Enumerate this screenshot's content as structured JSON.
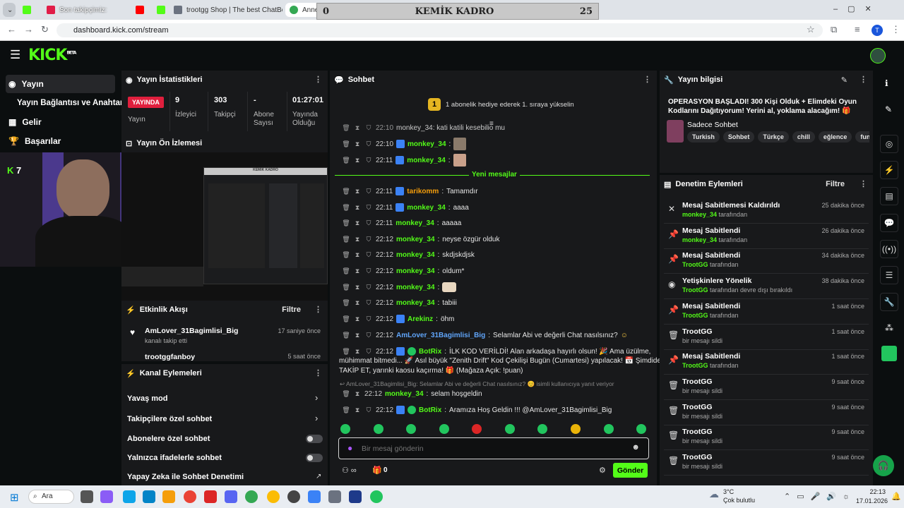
{
  "browser": {
    "tabs": [
      {
        "label": "Son takipçimiz:"
      },
      {
        "label": "trootgg Shop | The best ChatBot"
      },
      {
        "label": "Annecy · Google Haritalar"
      }
    ],
    "overlay_left": "0",
    "overlay_title": "KEMİK KADRO",
    "overlay_right": "25",
    "url": "dashboard.kick.com/stream",
    "profile_initial": "T"
  },
  "sidebar": {
    "items": [
      {
        "label": "Yayın",
        "icon": "stream-icon"
      },
      {
        "label": "Yayın Bağlantısı ve Anahtarı",
        "icon": ""
      },
      {
        "label": "Gelir",
        "icon": "revenue-icon"
      },
      {
        "label": "Başarılar",
        "icon": "trophy-icon"
      }
    ]
  },
  "stats": {
    "title": "Yayın İstatistikleri",
    "live_badge": "YAYINDA",
    "live_label": "Yayın",
    "cols": [
      {
        "value": "9",
        "label": "İzleyici"
      },
      {
        "value": "303",
        "label": "Takipçi"
      },
      {
        "value": "-",
        "label": "Abone Sayısı"
      },
      {
        "value": "01:27:01",
        "label": "Yayında Olduğu"
      }
    ]
  },
  "preview": {
    "title": "Yayın Ön İzlemesi",
    "cam_counter": "7",
    "inner_title": "KEMİK KADRO"
  },
  "activity": {
    "title": "Etkinlik Akışı",
    "filter": "Filtre",
    "items": [
      {
        "user": "AmLover_31Bagimlisi_Big",
        "action": "kanalı takip etti",
        "time": "17 saniye önce"
      },
      {
        "user": "trootggfanboy",
        "action": "",
        "time": "5 saat önce"
      }
    ]
  },
  "channel_actions": {
    "title": "Kanal Eylemeleri",
    "items": [
      {
        "label": "Yavaş mod",
        "type": "arrow"
      },
      {
        "label": "Takipçilere özel sohbet",
        "type": "arrow"
      },
      {
        "label": "Abonelere özel sohbet",
        "type": "toggle"
      },
      {
        "label": "Yalnızca ifadelerle sohbet",
        "type": "toggle"
      },
      {
        "label": "Yapay Zeka ile Sohbet Denetimi",
        "type": "link"
      }
    ]
  },
  "chat": {
    "title": "Sohbet",
    "pinned_rank": "1",
    "pinned_text": "1 abonelik hediye ederek 1. sıraya yükselin",
    "top_partial": "monkey_34: kati katili kesebilio mu",
    "top_partial_time": "22:10",
    "new_messages": "Yeni mesajlar",
    "messages": [
      {
        "time": "22:10",
        "user": "monkey_34",
        "text": ""
      },
      {
        "time": "22:11",
        "user": "monkey_34",
        "text": ""
      },
      {
        "time": "22:11",
        "user": "tarikomm",
        "text": "Tamamdır"
      },
      {
        "time": "22:11",
        "user": "monkey_34",
        "text": "aaaa"
      },
      {
        "time": "22:11",
        "user": "monkey_34",
        "text": "aaaaa"
      },
      {
        "time": "22:12",
        "user": "monkey_34",
        "text": "neyse özgür olduk"
      },
      {
        "time": "22:12",
        "user": "monkey_34",
        "text": "skdjskdjsk"
      },
      {
        "time": "22:12",
        "user": "monkey_34",
        "text": "oldum*"
      },
      {
        "time": "22:12",
        "user": "monkey_34",
        "text": ""
      },
      {
        "time": "22:12",
        "user": "monkey_34",
        "text": "tabiii"
      },
      {
        "time": "22:12",
        "user": "Arekinz",
        "text": "öhm"
      },
      {
        "time": "22:12",
        "user": "AmLover_31Bagimlisi_Big",
        "text": "Selamlar Abi ve değerli Chat nasılsınız?"
      }
    ],
    "botrix_1_time": "22:12",
    "botrix_user": "BotRix",
    "botrix_1_line1": "İLK KOD VERİLDİ! Alan arkadaşa hayırlı olsun! 🎉 Ama üzülme,",
    "botrix_1_line2": "mühimmat bitmedi... 🚀 Asıl büyük \"Zenith Drift\" Kod Çekilişi Bugün (Cumartesi) yapılacak! 📅 Şimdiden",
    "botrix_1_line3": "TAKİP ET, yarınki kaosu kaçırma! 🎁 (Mağaza Açık: !puan)",
    "reply_context": "AmLover_31Bagimlisi_Big: Selamlar Abi ve değerli Chat nasılsınız? 😊 isimli kullanıcıya yanıt veriyor",
    "reply_time": "22:12",
    "reply_user": "monkey_34",
    "reply_text": "selam hoşgeldin",
    "botrix_2_time": "22:12",
    "botrix_2_text": "Aramıza Hoş Geldin !!! @AmLover_31Bagimlisi_Big",
    "input_placeholder": "Bir mesaj gönderin",
    "points": "0",
    "send_label": "Gönder"
  },
  "stream_info": {
    "title": "Yayın bilgisi",
    "headline_line1": "OPERASYON BAŞLADI! 300 Kişi Olduk + Elimdeki Oyun",
    "headline_line2": "Kodlarını Dağıtıyorum! Yerini al, yoklama alacağım!",
    "category": "Sadece Sohbet",
    "tags": [
      "Turkish",
      "Sohbet",
      "Türkçe",
      "chill",
      "eğlence",
      "funny"
    ]
  },
  "moderation": {
    "title": "Denetim Eylemleri",
    "filter": "Filtre",
    "items": [
      {
        "title": "Mesaj Sabitlemesi Kaldırıldı",
        "by": "monkey_34",
        "suffix": "tarafından",
        "time": "25 dakika önce",
        "icon": "unpin-icon"
      },
      {
        "title": "Mesaj Sabitlendi",
        "by": "monkey_34",
        "suffix": "tarafından",
        "time": "26 dakika önce",
        "icon": "pin-icon"
      },
      {
        "title": "Mesaj Sabitlendi",
        "by": "TrootGG",
        "suffix": "tarafından",
        "time": "34 dakika önce",
        "icon": "pin-icon"
      },
      {
        "title": "Yetişkinlere Yönelik",
        "by": "TrootGG",
        "suffix": "tarafından devre dışı bırakıldı",
        "time": "38 dakika önce",
        "icon": "eye-icon"
      },
      {
        "title": "Mesaj Sabitlendi",
        "by": "TrootGG",
        "suffix": "tarafından",
        "time": "1 saat önce",
        "icon": "pin-icon"
      },
      {
        "title": "TrootGG",
        "by": "",
        "suffix": "bir mesajı sildi",
        "time": "1 saat önce",
        "icon": "trash-icon"
      },
      {
        "title": "Mesaj Sabitlendi",
        "by": "TrootGG",
        "suffix": "tarafından",
        "time": "1 saat önce",
        "icon": "pin-icon"
      },
      {
        "title": "TrootGG",
        "by": "",
        "suffix": "bir mesajı sildi",
        "time": "9 saat önce",
        "icon": "trash-icon"
      },
      {
        "title": "TrootGG",
        "by": "",
        "suffix": "bir mesajı sildi",
        "time": "9 saat önce",
        "icon": "trash-icon"
      },
      {
        "title": "TrootGG",
        "by": "",
        "suffix": "bir mesajı sildi",
        "time": "9 saat önce",
        "icon": "trash-icon"
      },
      {
        "title": "TrootGG",
        "by": "",
        "suffix": "bir mesajı sildi",
        "time": "9 saat önce",
        "icon": "trash-icon"
      }
    ]
  },
  "taskbar": {
    "search": "Ara",
    "weather_temp": "3°C",
    "weather_desc": "Çok bulutlu",
    "time": "22:13",
    "date": "17.01.2026"
  }
}
